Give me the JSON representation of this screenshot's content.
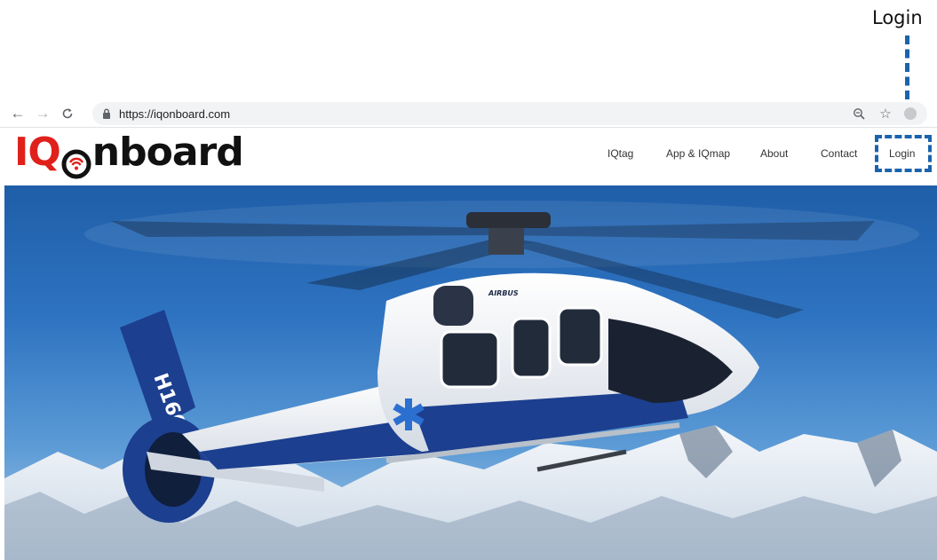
{
  "annotation": {
    "label": "Login",
    "color": "#1b63ad"
  },
  "browser": {
    "back_icon": "back-arrow-icon",
    "forward_icon": "forward-arrow-icon",
    "reload_icon": "reload-icon",
    "url": "https://iqonboard.com",
    "zoom_icon": "zoom-icon",
    "bookmark_icon": "star-icon"
  },
  "site": {
    "logo": {
      "part1": "IQ",
      "part2": "nboard",
      "accent": "#e0201b"
    },
    "nav": [
      {
        "label": "IQtag"
      },
      {
        "label": "App & IQmap"
      },
      {
        "label": "About"
      },
      {
        "label": "Contact"
      },
      {
        "label": "Login"
      }
    ]
  },
  "hero": {
    "tail_text": "H160",
    "body_text": "AIRBUS",
    "sky_color": "#2e73c1",
    "livery_color": "#1c3f8f"
  }
}
